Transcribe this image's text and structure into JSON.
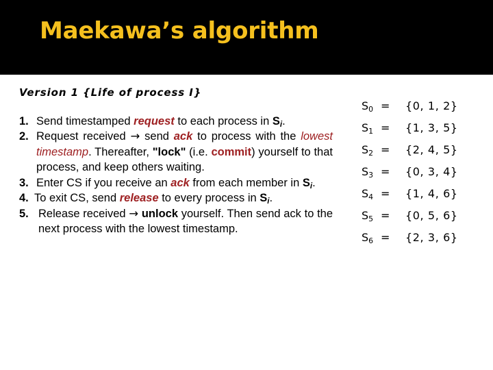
{
  "slide": {
    "title": "Maekawa’s algorithm",
    "title_color": "#F5C01E",
    "band_color": "#000000",
    "background_color": "#FFFFFF",
    "accent_red": "#9E2022"
  },
  "content": {
    "version_heading": "Version 1 {Life of process I}",
    "steps": [
      {
        "number": "1.",
        "segments": [
          {
            "text": "Send timestamped ",
            "style": "plain"
          },
          {
            "text": "request",
            "style": "red-bold-italic"
          },
          {
            "text": " to each process in ",
            "style": "plain"
          },
          {
            "text": "S",
            "style": "bold",
            "subscript": "i"
          },
          {
            "text": ".",
            "style": "plain"
          }
        ]
      },
      {
        "number": "2.",
        "segments": [
          {
            "text": "Request received ",
            "style": "plain"
          },
          {
            "text": "→",
            "style": "arrow"
          },
          {
            "text": " send ",
            "style": "plain"
          },
          {
            "text": "ack",
            "style": "red-bold-italic"
          },
          {
            "text": " to process with the ",
            "style": "plain"
          },
          {
            "text": "lowest timestamp",
            "style": "red-italic"
          },
          {
            "text": ". Thereafter, ",
            "style": "plain"
          },
          {
            "text": "\"lock\"",
            "style": "black-bold"
          },
          {
            "text": " (i.e. ",
            "style": "plain"
          },
          {
            "text": "commit",
            "style": "red-bold"
          },
          {
            "text": ") yourself to that process, and keep others waiting.",
            "style": "plain"
          }
        ]
      },
      {
        "number": "3.",
        "segments": [
          {
            "text": "Enter CS if you receive an ",
            "style": "plain"
          },
          {
            "text": "ack",
            "style": "red-bold-italic"
          },
          {
            "text": " from each member in ",
            "style": "plain"
          },
          {
            "text": "S",
            "style": "bold",
            "subscript": "i"
          },
          {
            "text": ".",
            "style": "plain"
          }
        ]
      },
      {
        "number": "4.",
        "segments": [
          {
            "text": "To exit CS, send ",
            "style": "plain"
          },
          {
            "text": "release",
            "style": "red-bold-italic"
          },
          {
            "text": " to every process in ",
            "style": "plain"
          },
          {
            "text": "S",
            "style": "bold",
            "subscript": "i"
          },
          {
            "text": ".",
            "style": "plain"
          }
        ]
      },
      {
        "number": "5.",
        "segments": [
          {
            "text": "Release received ",
            "style": "plain"
          },
          {
            "text": "→",
            "style": "arrow"
          },
          {
            "text": " ",
            "style": "plain"
          },
          {
            "text": "unlock",
            "style": "black-bold"
          },
          {
            "text": " yourself. Then send ack to the next process with the lowest timestamp.",
            "style": "plain"
          }
        ]
      }
    ]
  },
  "quorum_sets": {
    "equals_symbol": "=",
    "rows": [
      {
        "name": "S",
        "index": "0",
        "value": "{0, 1, 2}"
      },
      {
        "name": "S",
        "index": "1",
        "value": "{1, 3, 5}"
      },
      {
        "name": "S",
        "index": "2",
        "value": "{2, 4, 5}"
      },
      {
        "name": "S",
        "index": "3",
        "value": "{0, 3, 4}"
      },
      {
        "name": "S",
        "index": "4",
        "value": "{1, 4, 6}"
      },
      {
        "name": "S",
        "index": "5",
        "value": "{0, 5, 6}"
      },
      {
        "name": "S",
        "index": "6",
        "value": "{2, 3, 6}"
      }
    ]
  }
}
